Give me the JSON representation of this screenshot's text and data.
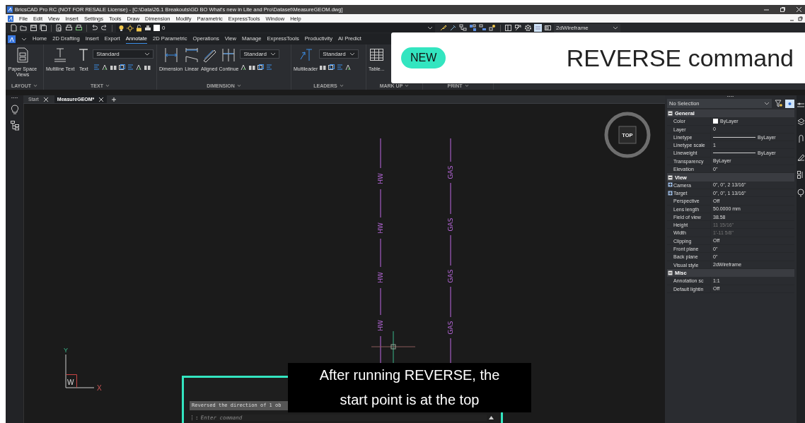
{
  "window": {
    "title": "BricsCAD Pro RC (NOT FOR RESALE License) - [C:\\Data\\26.1 Breakouts\\GD BO What's new in Lite and Pro\\Dataset\\MeasureGEOM.dwg]"
  },
  "menu": [
    "File",
    "Edit",
    "View",
    "Insert",
    "Settings",
    "Tools",
    "Draw",
    "Dimension",
    "Modify",
    "Parametric",
    "ExpressTools",
    "Window",
    "Help"
  ],
  "toolbar": {
    "layer": "0",
    "visual_style": "2dWireframe"
  },
  "ribbon_tabs": [
    {
      "label": "Home",
      "selected": false
    },
    {
      "label": "2D Drafting",
      "selected": false
    },
    {
      "label": "Insert",
      "selected": false
    },
    {
      "label": "Export",
      "selected": false
    },
    {
      "label": "Annotate",
      "selected": true
    },
    {
      "label": "2D Parametric",
      "selected": false
    },
    {
      "label": "Operations",
      "selected": false
    },
    {
      "label": "View",
      "selected": false
    },
    {
      "label": "Manage",
      "selected": false
    },
    {
      "label": "ExpressTools",
      "selected": false
    },
    {
      "label": "Productivity",
      "selected": false
    },
    {
      "label": "AI Predict",
      "selected": false
    }
  ],
  "ribbon_panels": [
    {
      "label": "LAYOUT",
      "tools": [
        "Paper Space Views"
      ]
    },
    {
      "label": "TEXT",
      "tools": [
        "Multiline Text",
        "Text"
      ],
      "style": "Standard"
    },
    {
      "label": "DIMENSION",
      "tools": [
        "Dimension",
        "Linear",
        "Aligned",
        "Continue"
      ],
      "style": "Standard"
    },
    {
      "label": "LEADERS",
      "tools": [
        "Multileader"
      ],
      "style": "Standard"
    },
    {
      "label": "MARK UP",
      "tools": [
        "Table..."
      ]
    },
    {
      "label": "PRINT"
    }
  ],
  "banner": {
    "badge": "NEW",
    "title": "REVERSE command"
  },
  "doc_tabs": [
    {
      "label": "Start",
      "selected": false
    },
    {
      "label": "MeasureGEOM*",
      "selected": true
    }
  ],
  "drawing": {
    "pipes": [
      {
        "labels": [
          "HW",
          "HW",
          "HW",
          "HW"
        ]
      },
      {
        "labels": [
          "GAS",
          "GAS",
          "GAS",
          "GAS"
        ]
      }
    ],
    "viewcube": "TOP",
    "ucs": {
      "y": "Y",
      "x": "X",
      "w": "W"
    }
  },
  "properties": {
    "selection": "No Selection",
    "groups": [
      {
        "name": "General",
        "expanded": true,
        "rows": [
          {
            "name": "Color",
            "value": "ByLayer",
            "kind": "swatch",
            "disabled": false
          },
          {
            "name": "Layer",
            "value": "0",
            "kind": "text",
            "disabled": false
          },
          {
            "name": "Linetype",
            "value": "ByLayer",
            "kind": "line",
            "disabled": false
          },
          {
            "name": "Linetype scale",
            "value": "1",
            "kind": "text",
            "disabled": false
          },
          {
            "name": "Lineweight",
            "value": "ByLayer",
            "kind": "line",
            "disabled": false
          },
          {
            "name": "Transparency",
            "value": "ByLayer",
            "kind": "text",
            "disabled": false
          },
          {
            "name": "Elevation",
            "value": "0\"",
            "kind": "text",
            "disabled": false
          }
        ]
      },
      {
        "name": "View",
        "expanded": true,
        "rows": [
          {
            "name": "Camera",
            "value": "0\", 0\", 2 13/16\"",
            "kind": "sub",
            "expanded": false,
            "disabled": false
          },
          {
            "name": "Target",
            "value": "0\", 0\", 1 13/16\"",
            "kind": "sub",
            "expanded": false,
            "disabled": false
          },
          {
            "name": "Perspective",
            "value": "Off",
            "kind": "text",
            "disabled": false
          },
          {
            "name": "Lens length",
            "value": "50.0000 mm",
            "kind": "text",
            "disabled": false
          },
          {
            "name": "Field of view",
            "value": "38.58",
            "kind": "text",
            "disabled": false
          },
          {
            "name": "Height",
            "value": "11 15/16\"",
            "kind": "text",
            "disabled": true
          },
          {
            "name": "Width",
            "value": "1'-11 5/8\"",
            "kind": "text",
            "disabled": true
          },
          {
            "name": "Clipping",
            "value": "Off",
            "kind": "text",
            "disabled": false
          },
          {
            "name": "Front plane",
            "value": "0\"",
            "kind": "text",
            "disabled": false
          },
          {
            "name": "Back plane",
            "value": "0\"",
            "kind": "text",
            "disabled": false
          },
          {
            "name": "Visual style",
            "value": "2dWireframe",
            "kind": "text",
            "disabled": false
          }
        ]
      },
      {
        "name": "Misc",
        "expanded": true,
        "rows": [
          {
            "name": "Annotation sc",
            "value": "1:1",
            "kind": "text",
            "disabled": false
          },
          {
            "name": "Default lightin",
            "value": "Off",
            "kind": "text",
            "disabled": false
          }
        ]
      }
    ]
  },
  "command_line": {
    "history": "Reversed the direction of 1 ob",
    "prompt": ":",
    "placeholder": "Enter command"
  },
  "caption": "After running REVERSE, the start point is at the top"
}
